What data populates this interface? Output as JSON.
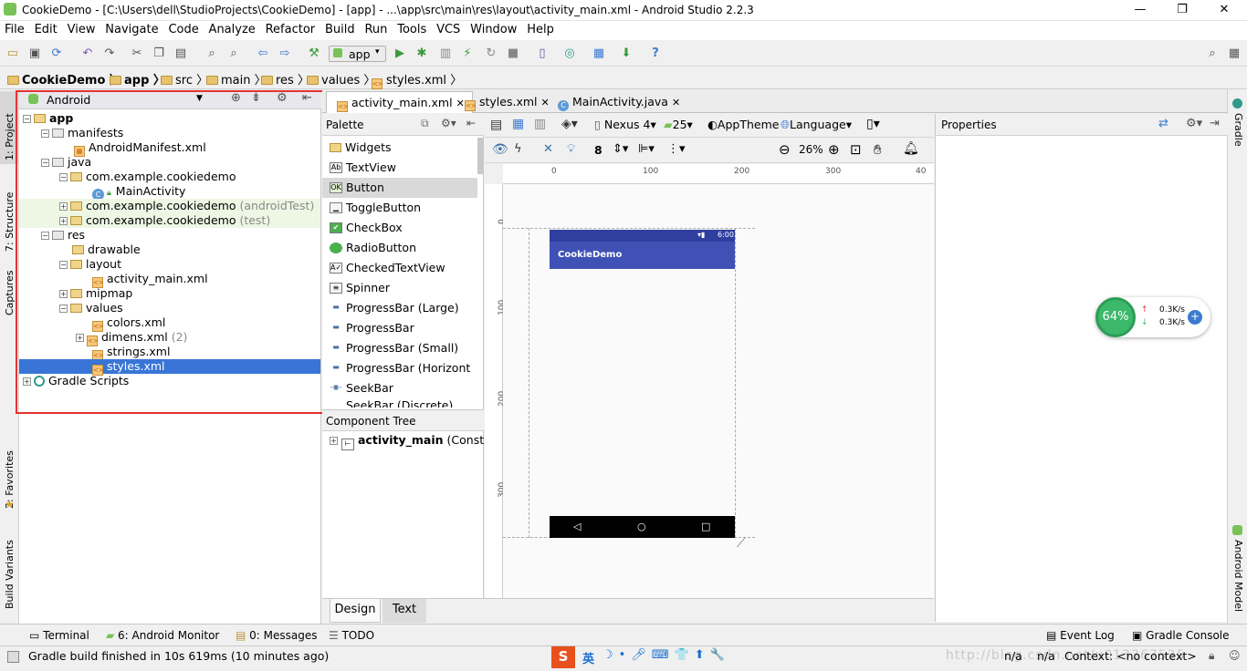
{
  "window": {
    "title": "CookieDemo - [C:\\Users\\dell\\StudioProjects\\CookieDemo] - [app] - ...\\app\\src\\main\\res\\layout\\activity_main.xml - Android Studio 2.2.3",
    "min": "—",
    "max": "❐",
    "close": "✕"
  },
  "menu": [
    "File",
    "Edit",
    "View",
    "Navigate",
    "Code",
    "Analyze",
    "Refactor",
    "Build",
    "Run",
    "Tools",
    "VCS",
    "Window",
    "Help"
  ],
  "toolbar": {
    "run_config": "app"
  },
  "breadcrumb": [
    "CookieDemo",
    "app",
    "src",
    "main",
    "res",
    "values",
    "styles.xml"
  ],
  "left_strip": [
    "1: Project",
    "7: Structure",
    "Captures",
    "2: Favorites",
    "Build Variants"
  ],
  "right_strip": [
    "Gradle",
    "Android Model"
  ],
  "project": {
    "view_mode": "Android",
    "tree": [
      {
        "label": "app",
        "bold": true
      },
      {
        "label": "manifests"
      },
      {
        "label": "AndroidManifest.xml"
      },
      {
        "label": "java"
      },
      {
        "label": "com.example.cookiedemo"
      },
      {
        "label": "MainActivity"
      },
      {
        "label": "com.example.cookiedemo",
        "suffix": "(androidTest)"
      },
      {
        "label": "com.example.cookiedemo",
        "suffix": "(test)"
      },
      {
        "label": "res"
      },
      {
        "label": "drawable"
      },
      {
        "label": "layout"
      },
      {
        "label": "activity_main.xml"
      },
      {
        "label": "mipmap"
      },
      {
        "label": "values"
      },
      {
        "label": "colors.xml"
      },
      {
        "label": "dimens.xml",
        "suffix": "(2)"
      },
      {
        "label": "strings.xml"
      },
      {
        "label": "styles.xml"
      },
      {
        "label": "Gradle Scripts"
      }
    ]
  },
  "tabs": [
    "activity_main.xml",
    "styles.xml",
    "MainActivity.java"
  ],
  "palette": {
    "title": "Palette",
    "group": "Widgets",
    "items": [
      "TextView",
      "Button",
      "ToggleButton",
      "CheckBox",
      "RadioButton",
      "CheckedTextView",
      "Spinner",
      "ProgressBar (Large)",
      "ProgressBar",
      "ProgressBar (Small)",
      "ProgressBar (Horizont",
      "SeekBar",
      "SeekBar (Discrete)"
    ],
    "selected": "Button"
  },
  "component_tree": {
    "title": "Component Tree",
    "root": "activity_main",
    "root_suffix": "(Constra"
  },
  "design_toolbar": {
    "device": "Nexus 4",
    "api": "25",
    "theme": "AppTheme",
    "language": "Language",
    "zoom": "26%",
    "margin": "8"
  },
  "ruler": {
    "h": [
      "0",
      "100",
      "200",
      "300",
      "40"
    ],
    "v": [
      "0",
      "100",
      "200",
      "300"
    ]
  },
  "phone": {
    "time": "6:00",
    "app_title": "CookieDemo"
  },
  "properties": {
    "title": "Properties"
  },
  "design_tabs": [
    "Design",
    "Text"
  ],
  "widget": {
    "percent": "64%",
    "up": "0.3K/s",
    "down": "0.3K/s"
  },
  "bottom_tools": [
    "Terminal",
    "6: Android Monitor",
    "0: Messages",
    "TODO",
    "Event Log",
    "Gradle Console"
  ],
  "status": {
    "message": "Gradle build finished in 10s 619ms (10 minutes ago)",
    "na1": "n/a",
    "na2": "n/a",
    "context": "Context: <no context>",
    "watermark": "http://blog.csdn.net/u013367535",
    "ime": "英"
  },
  "colors": {
    "accent": "#3f51b5",
    "status_dark": "#303f9f",
    "selection": "#3875d7",
    "highlight_box": "#e53333"
  }
}
